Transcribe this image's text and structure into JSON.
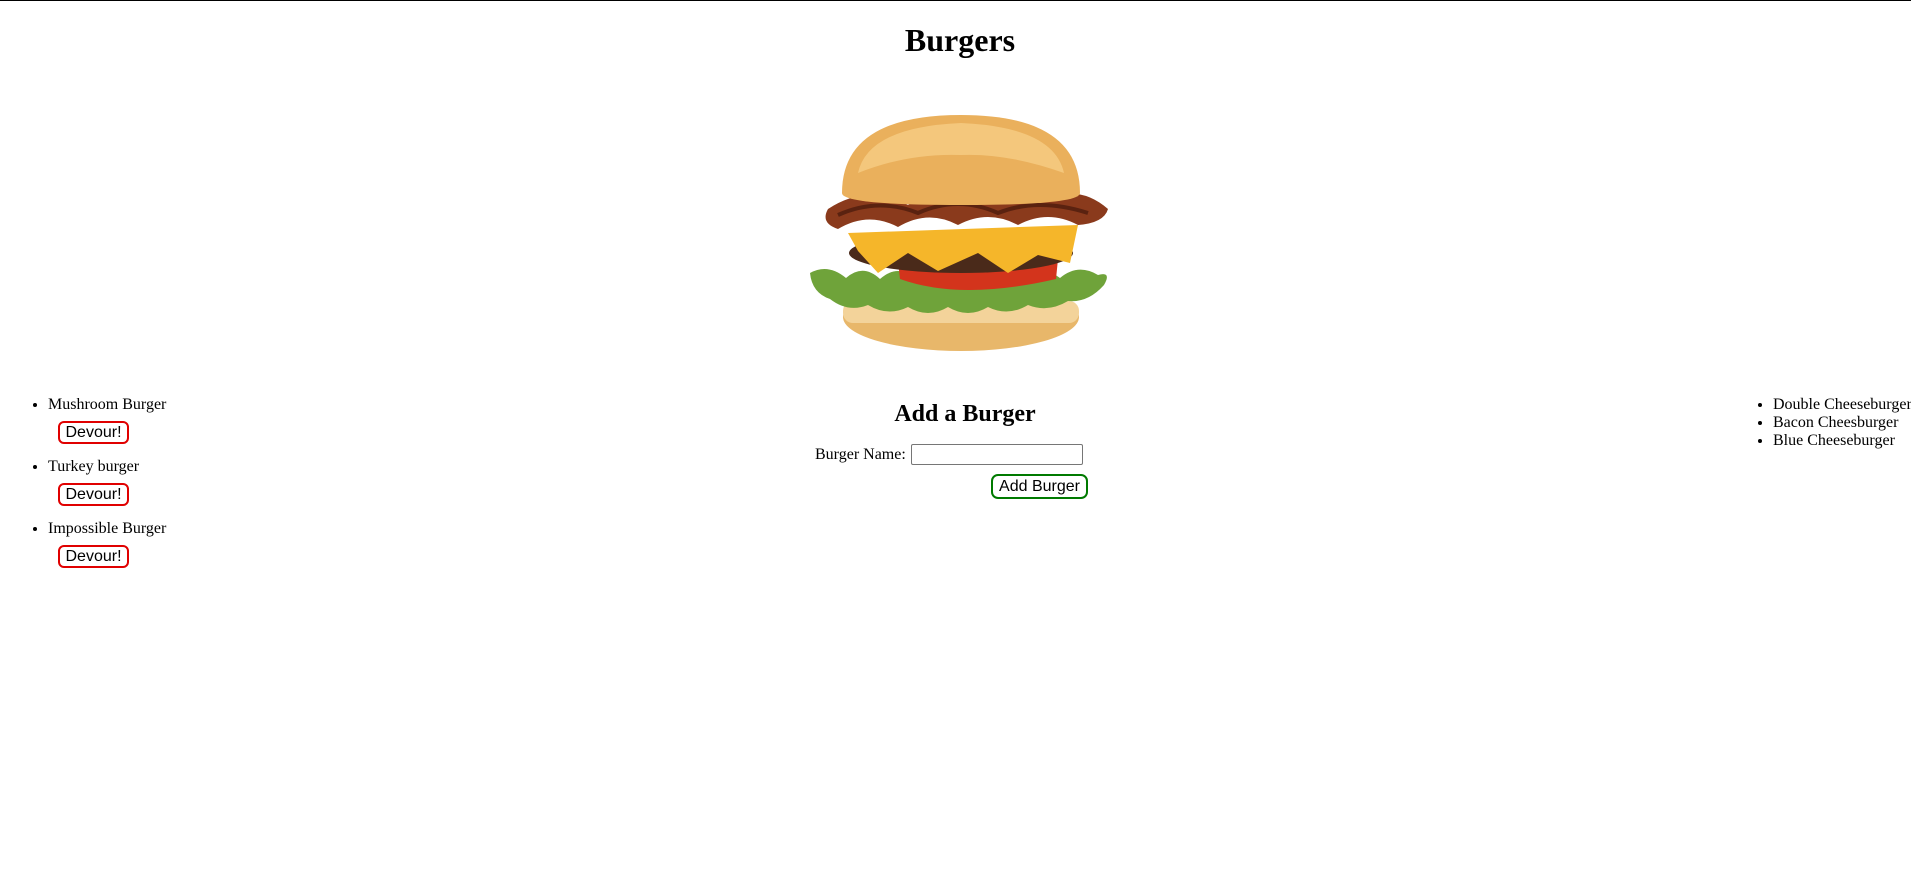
{
  "page": {
    "title": "Burgers"
  },
  "hero": {
    "image": "burger-photo"
  },
  "uneaten": {
    "items": [
      {
        "name": "Mushroom Burger",
        "button": "Devour!"
      },
      {
        "name": "Turkey burger",
        "button": "Devour!"
      },
      {
        "name": "Impossible Burger",
        "button": "Devour!"
      }
    ]
  },
  "form": {
    "title": "Add a Burger",
    "label": "Burger Name:",
    "value": "",
    "submit": "Add Burger"
  },
  "devoured": {
    "items": [
      {
        "name": "Double Cheeseburger"
      },
      {
        "name": "Bacon Cheesburger"
      },
      {
        "name": "Blue Cheeseburger"
      }
    ]
  },
  "colors": {
    "devour_border": "#e00000",
    "add_border": "#007a00"
  }
}
